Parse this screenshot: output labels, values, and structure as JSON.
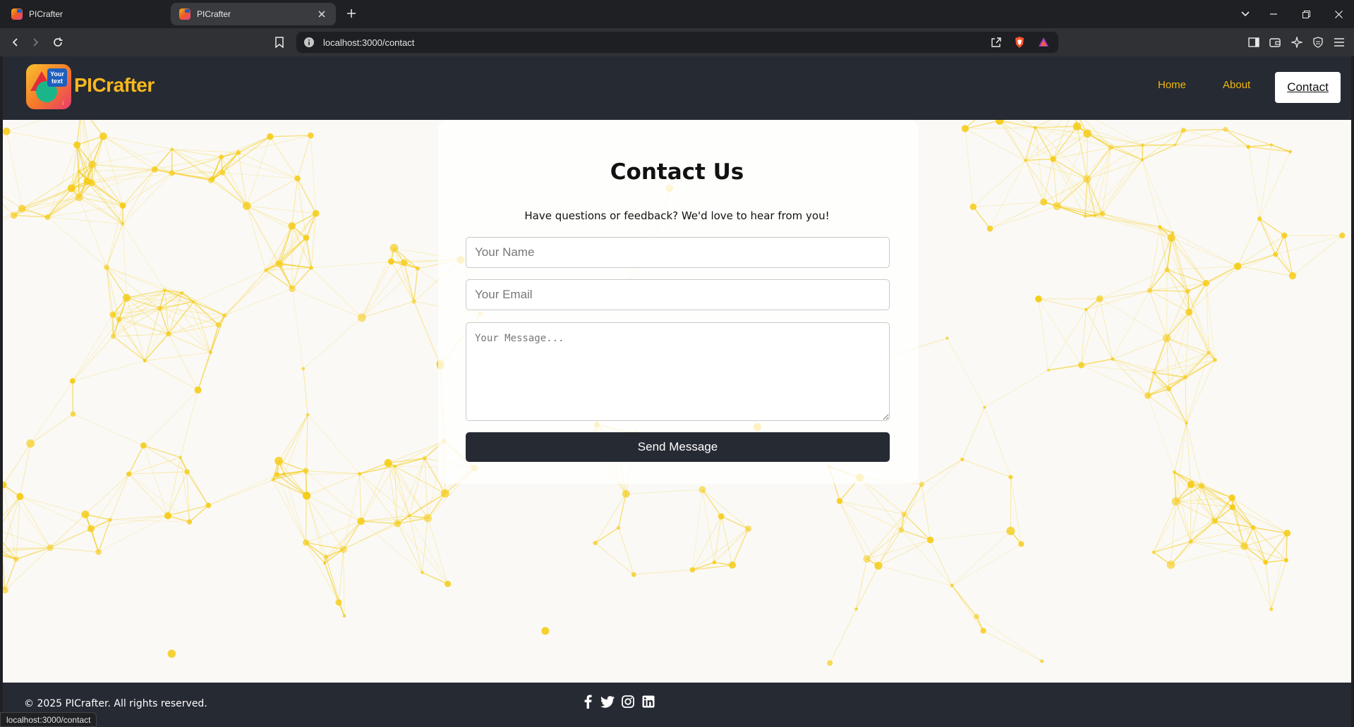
{
  "browser": {
    "tabs": [
      {
        "title": "PICrafter",
        "active": false
      },
      {
        "title": "PICrafter",
        "active": true
      }
    ],
    "url": "localhost:3000/contact",
    "status_url": "localhost:3000/contact"
  },
  "header": {
    "brand": "PICrafter",
    "logo_text": "Your text",
    "nav": {
      "home": "Home",
      "about": "About",
      "contact": "Contact"
    }
  },
  "contact": {
    "title": "Contact Us",
    "subtitle": "Have questions or feedback? We'd love to hear from you!",
    "name_placeholder": "Your Name",
    "email_placeholder": "Your Email",
    "message_placeholder": "Your Message...",
    "send_label": "Send Message"
  },
  "footer": {
    "copyright": "© 2025 PICrafter. All rights reserved.",
    "social_icons": [
      "facebook-icon",
      "twitter-icon",
      "instagram-icon",
      "linkedin-icon"
    ]
  },
  "colors": {
    "header_bg": "#262a33",
    "accent": "#f0b90b",
    "page_bg": "#faf9f6",
    "network": "#f5cc1a"
  }
}
